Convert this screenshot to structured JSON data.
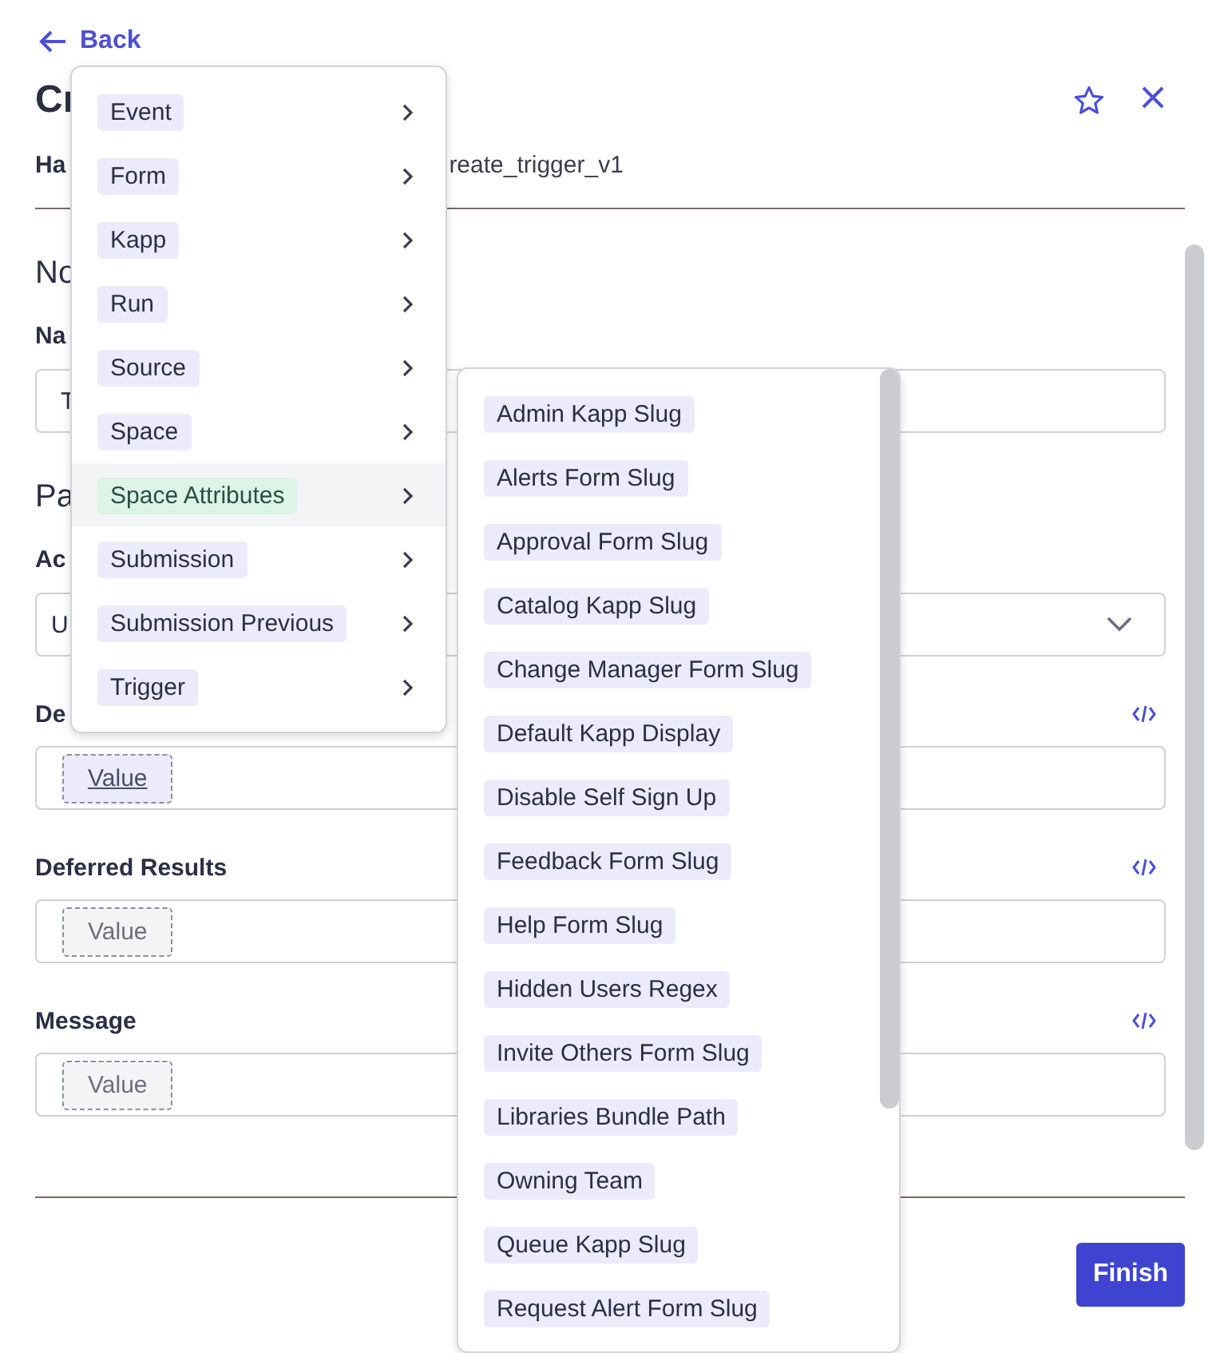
{
  "back_link": "Back",
  "title": "Cr",
  "handler": {
    "label": "Ha",
    "value": "reate_trigger_v1"
  },
  "form_items": [
    {
      "kind": "section",
      "text": "No"
    },
    {
      "kind": "text",
      "label": "Na",
      "value": "T"
    },
    {
      "kind": "section",
      "text": "Pa"
    },
    {
      "kind": "select",
      "label": "Ac",
      "value": "U"
    },
    {
      "kind": "value",
      "label": "De",
      "chip": "Value",
      "highlighted": true
    },
    {
      "kind": "value",
      "label": "Deferred Results",
      "chip": "Value",
      "highlighted": false
    },
    {
      "kind": "value",
      "label": "Message",
      "chip": "Value",
      "highlighted": false
    }
  ],
  "finish_button": "Finish",
  "menu": {
    "items": [
      {
        "label": "Event",
        "selected": false
      },
      {
        "label": "Form",
        "selected": false
      },
      {
        "label": "Kapp",
        "selected": false
      },
      {
        "label": "Run",
        "selected": false
      },
      {
        "label": "Source",
        "selected": false
      },
      {
        "label": "Space",
        "selected": false
      },
      {
        "label": "Space Attributes",
        "selected": true
      },
      {
        "label": "Submission",
        "selected": false
      },
      {
        "label": "Submission Previous",
        "selected": false
      },
      {
        "label": "Trigger",
        "selected": false
      }
    ]
  },
  "submenu": {
    "items": [
      "Admin Kapp Slug",
      "Alerts Form Slug",
      "Approval Form Slug",
      "Catalog Kapp Slug",
      "Change Manager Form Slug",
      "Default Kapp Display",
      "Disable Self Sign Up",
      "Feedback Form Slug",
      "Help Form Slug",
      "Hidden Users Regex",
      "Invite Others Form Slug",
      "Libraries Bundle Path",
      "Owning Team",
      "Queue Kapp Slug",
      "Request Alert Form Slug"
    ]
  }
}
